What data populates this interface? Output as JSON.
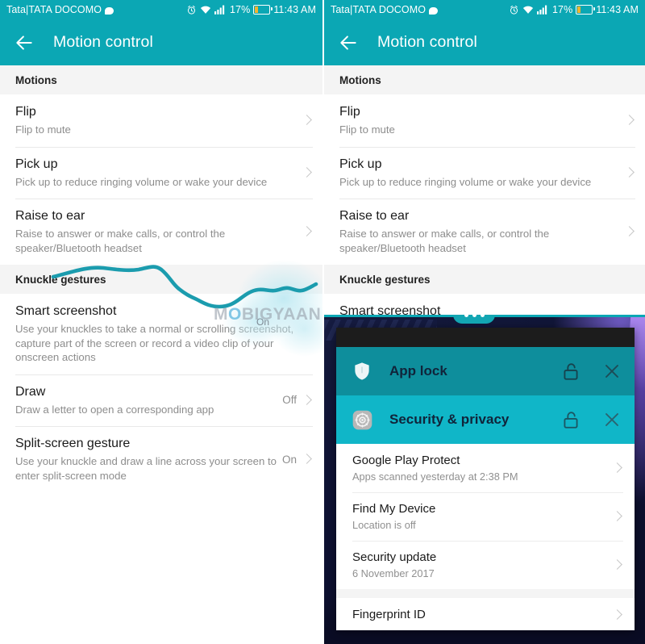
{
  "colors": {
    "teal_header": "#0ba7b4",
    "card_teal_dark": "#0e8e9c",
    "card_teal_light": "#10b6c8",
    "battery_fill": "#f5b32d",
    "stroke": "#1b9cae"
  },
  "status_bar": {
    "carrier": "Tata|TATA DOCOMO",
    "message_icon": "message-bubble-icon",
    "alarm_icon": "alarm-clock-icon",
    "wifi_icon": "wifi-icon",
    "signal_icon": "signal-bars-icon",
    "battery_percent": "17%",
    "battery_icon": "battery-icon",
    "time": "11:43 AM"
  },
  "app_bar": {
    "back_icon": "back-arrow-icon",
    "title": "Motion control"
  },
  "sections": [
    {
      "header": "Motions",
      "rows": [
        {
          "title": "Flip",
          "subtitle": "Flip to mute",
          "value": ""
        },
        {
          "title": "Pick up",
          "subtitle": "Pick up to reduce ringing volume or wake your device",
          "value": ""
        },
        {
          "title": "Raise to ear",
          "subtitle": "Raise to answer or make calls, or control the speaker/Bluetooth headset",
          "value": ""
        }
      ]
    },
    {
      "header": "Knuckle gestures",
      "rows": [
        {
          "title": "Smart screenshot",
          "subtitle": "Use your knuckles to take a normal or scrolling screenshot, capture part of the screen or record a video clip of your onscreen actions",
          "value": ""
        },
        {
          "title": "Draw",
          "subtitle": "Draw a letter to open a corresponding app",
          "value": "Off"
        },
        {
          "title": "Split-screen gesture",
          "subtitle": "Use your knuckle and draw a line across your screen to enter split-screen mode",
          "value": "On"
        }
      ]
    }
  ],
  "watermark": {
    "text_a": "M",
    "text_o": "O",
    "text_b": "BIGYAAN",
    "overlay_label": "On"
  },
  "split_screen": {
    "handle_icon": "split-screen-handle-icon",
    "handle_dots": 3,
    "recent_apps": [
      {
        "title": "App lock",
        "app_icon": "shield-icon",
        "lock_icon": "unlocked-padlock-icon",
        "close_icon": "close-icon"
      },
      {
        "title": "Security & privacy",
        "app_icon": "gear-icon",
        "lock_icon": "unlocked-padlock-icon",
        "close_icon": "close-icon"
      }
    ],
    "security_rows": [
      {
        "title": "Google Play Protect",
        "subtitle": "Apps scanned yesterday at 2:38 PM"
      },
      {
        "title": "Find My Device",
        "subtitle": "Location is off"
      },
      {
        "title": "Security update",
        "subtitle": "6 November 2017"
      }
    ],
    "security_rows_2": [
      {
        "title": "Fingerprint ID",
        "subtitle": ""
      }
    ]
  }
}
